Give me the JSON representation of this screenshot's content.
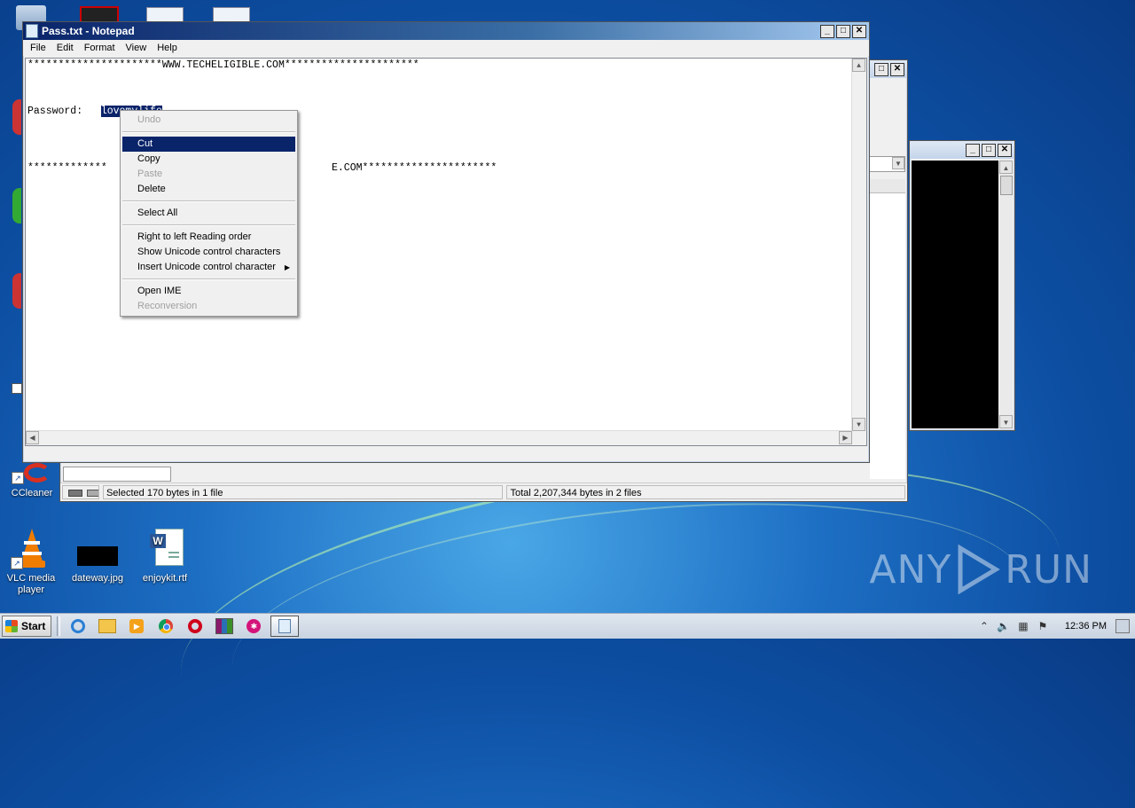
{
  "notepad": {
    "title": "Pass.txt - Notepad",
    "menu": [
      "File",
      "Edit",
      "Format",
      "View",
      "Help"
    ],
    "lines": {
      "banner_top": "**********************WWW.TECHELIGIBLE.COM**********************",
      "password_label": "Password:   ",
      "password_value": "lovemylife",
      "banner_bottom_left": "*************",
      "banner_bottom_right": "E.COM**********************"
    }
  },
  "context_menu": {
    "items": [
      {
        "label": "Undo",
        "state": "disabled"
      },
      {
        "sep": true
      },
      {
        "label": "Cut",
        "state": "highlighted"
      },
      {
        "label": "Copy",
        "state": "enabled"
      },
      {
        "label": "Paste",
        "state": "disabled"
      },
      {
        "label": "Delete",
        "state": "enabled"
      },
      {
        "sep": true
      },
      {
        "label": "Select All",
        "state": "enabled"
      },
      {
        "sep": true
      },
      {
        "label": "Right to left Reading order",
        "state": "enabled"
      },
      {
        "label": "Show Unicode control characters",
        "state": "enabled"
      },
      {
        "label": "Insert Unicode control character",
        "state": "enabled",
        "submenu": true
      },
      {
        "sep": true
      },
      {
        "label": "Open IME",
        "state": "enabled"
      },
      {
        "label": "Reconversion",
        "state": "disabled"
      }
    ]
  },
  "explorer": {
    "status_selected": "Selected 170 bytes in 1 file",
    "status_total": "Total 2,207,344 bytes in 2 files"
  },
  "desktop_icons": [
    {
      "label": "CCleaner",
      "icon": "ccleaner-icon"
    },
    {
      "label": "VLC media player",
      "icon": "vlc-icon"
    },
    {
      "label": "dateway.jpg",
      "icon": "image-file-icon"
    },
    {
      "label": "enjoykit.rtf",
      "icon": "word-document-icon"
    }
  ],
  "taskbar": {
    "start_label": "Start",
    "clock": "12:36 PM",
    "pinned": [
      "internet-explorer-icon",
      "file-explorer-icon",
      "media-player-icon",
      "chrome-icon",
      "opera-icon",
      "winrar-icon",
      "media-app-icon"
    ]
  },
  "watermark": {
    "text_left": "ANY",
    "text_right": "RUN"
  },
  "colors": {
    "selection": "#0a246a",
    "desktop": "#1d6fc4"
  }
}
